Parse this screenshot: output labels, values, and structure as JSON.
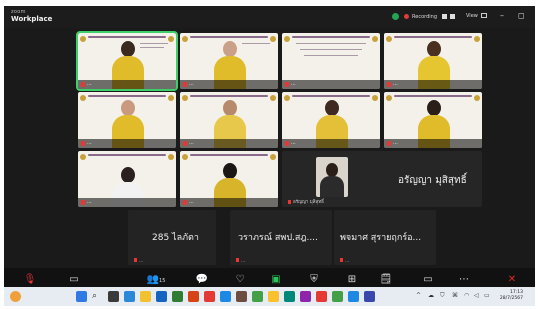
{
  "app": {
    "brand_small": "zoom",
    "brand": "Workplace"
  },
  "titlebar": {
    "recording": "Recording",
    "view": "View"
  },
  "tiles": [
    {
      "label": "..."
    },
    {
      "label": "..."
    },
    {
      "label": "..."
    },
    {
      "label": "..."
    },
    {
      "label": "..."
    },
    {
      "label": "..."
    },
    {
      "label": "..."
    },
    {
      "label": "..."
    },
    {
      "label": "..."
    },
    {
      "label": "..."
    },
    {
      "label": "..."
    },
    {
      "label": "..."
    }
  ],
  "featured": {
    "name": "อรัญญา มุสิสุทธิ์",
    "label": "อรัญญา มุสิสุทธิ์"
  },
  "name_tiles": [
    {
      "name": "285 ไลภัตา",
      "label": "..."
    },
    {
      "name": "วราภรณ์ สพป.สฎ....",
      "label": "..."
    },
    {
      "name": "พจมาศ สุรายฤกร์อ...",
      "label": "..."
    }
  ],
  "toolbar": [
    "Audio",
    "Video",
    "Participants",
    "Chat",
    "React",
    "Share",
    "Host tools",
    "Apps",
    "Notes",
    "Whiteboards",
    "More",
    "End"
  ],
  "participants_count": "15",
  "clock": {
    "time": "17:13",
    "date": "28/7/2567"
  },
  "colors": {
    "accent": "#3fcf6a",
    "shirt": "#e0bb2a",
    "end": "#e02828"
  }
}
